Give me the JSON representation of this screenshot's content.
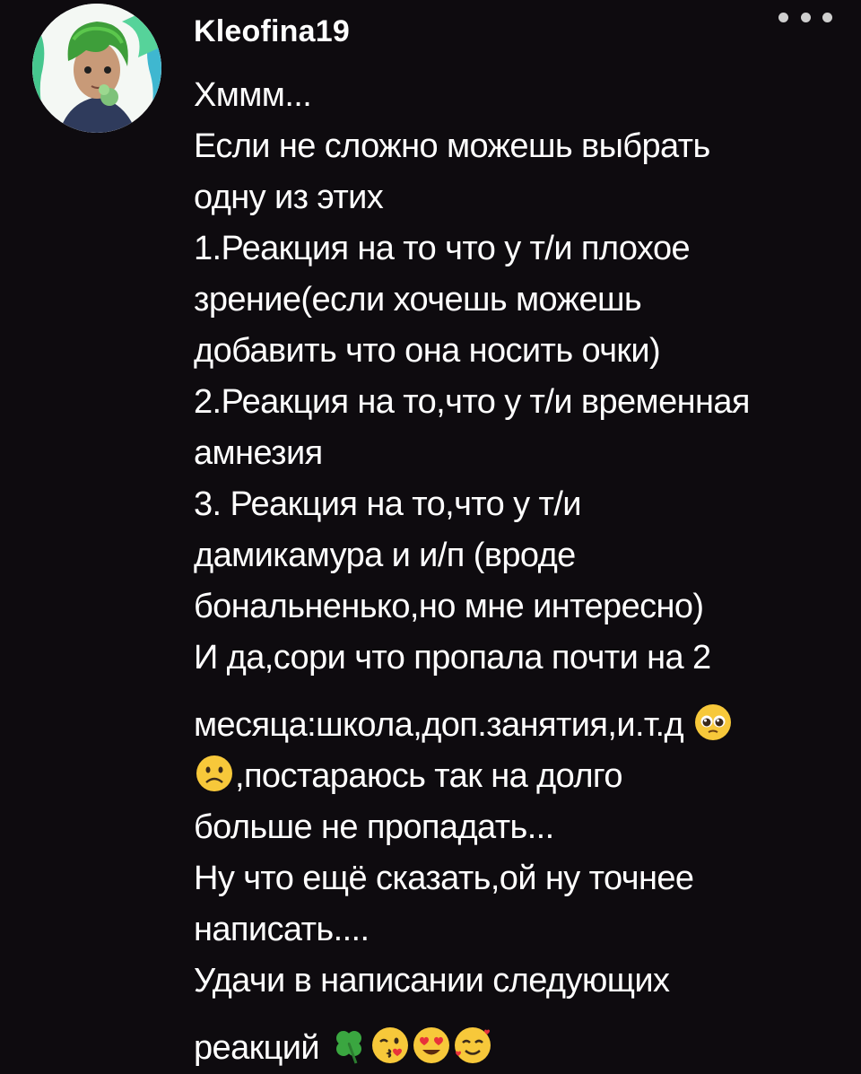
{
  "comment": {
    "username": "Kleofina19",
    "avatar_icon": "avatar-boy-green-hair",
    "more_icon": "more-dots-icon",
    "lines": {
      "l1": "Хммм...",
      "l2": "Если не сложно можешь выбрать",
      "l3": "одну из этих",
      "l4": "1.Реакция на то что у т/и плохое",
      "l5": "зрение(если хочешь можешь",
      "l6": "добавить что она носить очки)",
      "l7": "2.Реакция на то,что у т/и временная",
      "l8": "амнезия",
      "l9": "3. Реакция на то,что у т/и",
      "l10": "дамикамура и и/п (вроде",
      "l11": "бональненько,но мне интересно)",
      "l12": "И да,сори что пропала почти на 2",
      "l13": "месяца:школа,доп.занятия,и.т.д",
      "l14": ",постараюсь так на долго",
      "l15": "больше не пропадать...",
      "l16": "Ну что ещё сказать,ой ну точнее",
      "l17": "написать....",
      "l18": "Удачи в написании следующих",
      "l19": "реакций"
    },
    "emojis": [
      "pleading-face-emoji",
      "frowning-face-emoji",
      "four-leaf-clover-emoji",
      "kissing-face-emoji",
      "heart-eyes-emoji",
      "smiling-face-hearts-emoji"
    ],
    "colors": {
      "background": "#0e0b0f",
      "text": "#ffffff",
      "more_dots": "#cfcfcf"
    }
  }
}
